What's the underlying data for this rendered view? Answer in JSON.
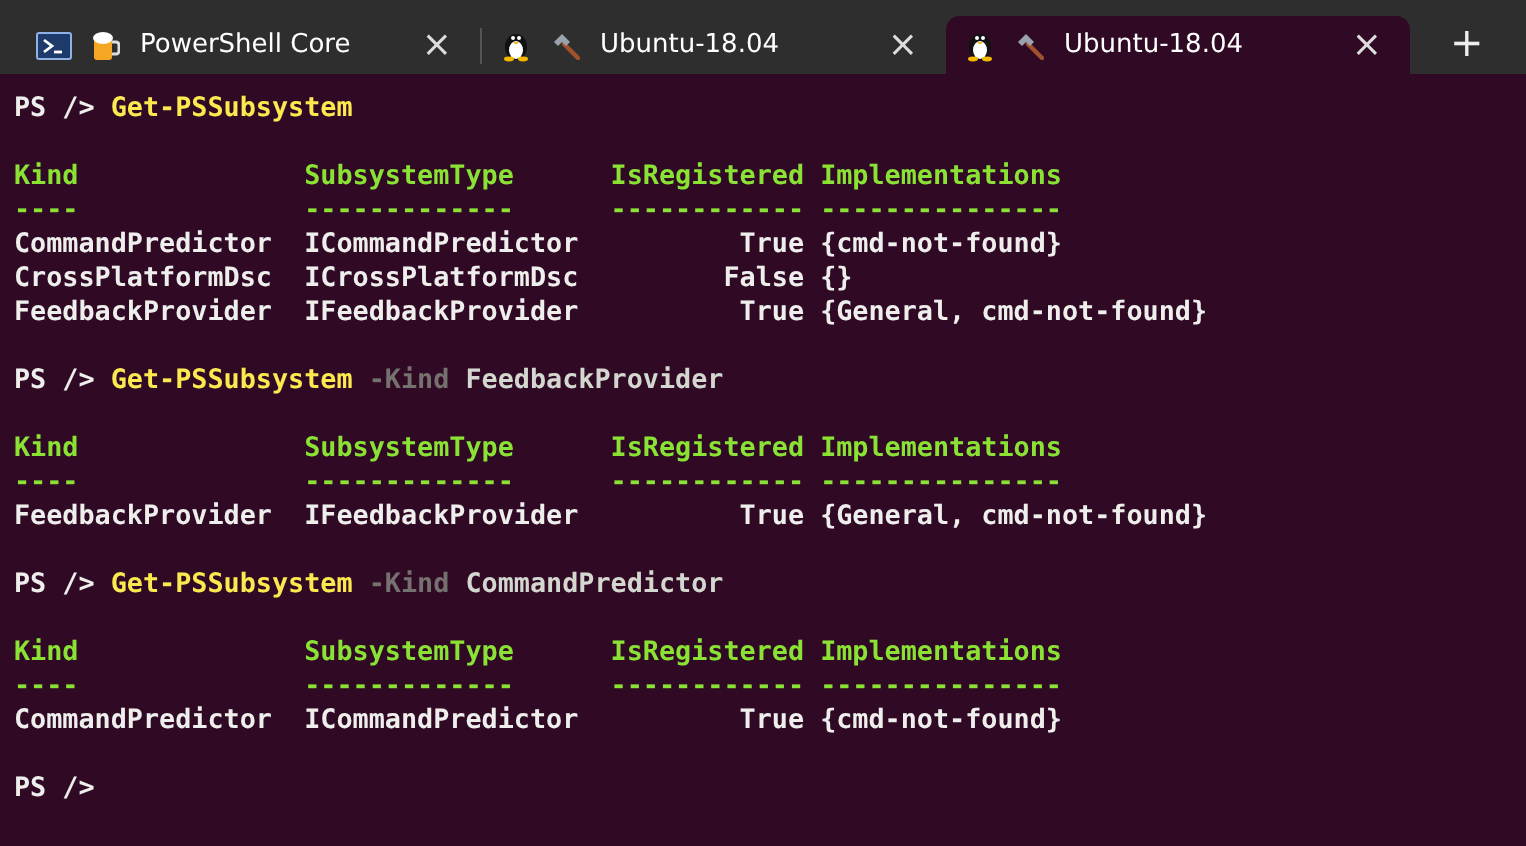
{
  "tabs": [
    {
      "kind": "powershell",
      "title": "PowerShell Core",
      "close": "×",
      "selected": false
    },
    {
      "kind": "ubuntu",
      "title": "Ubuntu-18.04",
      "close": "×",
      "selected": false
    },
    {
      "kind": "ubuntu",
      "title": "Ubuntu-18.04",
      "close": "×",
      "selected": true
    }
  ],
  "new_tab": "+",
  "terminal": [
    {
      "kind": "command",
      "prompt": "PS />",
      "command": "Get-PSSubsystem"
    },
    {
      "kind": "table",
      "columns": [
        "Kind",
        "SubsystemType",
        "IsRegistered",
        "Implementations"
      ],
      "rules": [
        "----",
        "-------------",
        "------------",
        "---------------"
      ],
      "rows": [
        [
          "CommandPredictor",
          "ICommandPredictor",
          "True",
          "{cmd-not-found}"
        ],
        [
          "CrossPlatformDsc",
          "ICrossPlatformDsc",
          "False",
          "{}"
        ],
        [
          "FeedbackProvider",
          "IFeedbackProvider",
          "True",
          "{General, cmd-not-found}"
        ]
      ]
    },
    {
      "kind": "command",
      "prompt": "PS />",
      "command": "Get-PSSubsystem",
      "parameter": "-Kind",
      "argument": "FeedbackProvider"
    },
    {
      "kind": "table",
      "columns": [
        "Kind",
        "SubsystemType",
        "IsRegistered",
        "Implementations"
      ],
      "rules": [
        "----",
        "-------------",
        "------------",
        "---------------"
      ],
      "rows": [
        [
          "FeedbackProvider",
          "IFeedbackProvider",
          "True",
          "{General, cmd-not-found}"
        ]
      ]
    },
    {
      "kind": "command",
      "prompt": "PS />",
      "command": "Get-PSSubsystem",
      "parameter": "-Kind",
      "argument": "CommandPredictor"
    },
    {
      "kind": "table",
      "columns": [
        "Kind",
        "SubsystemType",
        "IsRegistered",
        "Implementations"
      ],
      "rules": [
        "----",
        "-------------",
        "------------",
        "---------------"
      ],
      "rows": [
        [
          "CommandPredictor",
          "ICommandPredictor",
          "True",
          "{cmd-not-found}"
        ]
      ]
    },
    {
      "kind": "command",
      "prompt": "PS />"
    }
  ]
}
